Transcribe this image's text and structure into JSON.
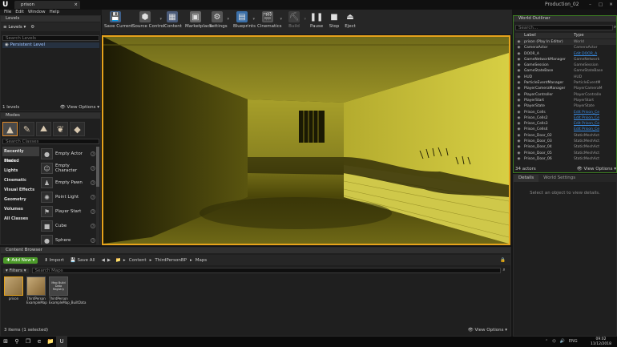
{
  "title_bar": {
    "doc_tab": "prison",
    "project_name": "Production_02",
    "controls": [
      "–",
      "□",
      "✕"
    ]
  },
  "menu": [
    "File",
    "Edit",
    "Window",
    "Help"
  ],
  "levels_panel": {
    "tab": "Levels",
    "levels_button": "Levels",
    "search_placeholder": "Search Levels",
    "persistent_level": "Persistent Level",
    "count": "1 levels",
    "view_options": "View Options"
  },
  "modes_panel": {
    "tab": "Modes",
    "search_placeholder": "Search Classes",
    "categories": [
      "Recently Placed",
      "Basic",
      "Lights",
      "Cinematic",
      "Visual Effects",
      "Geometry",
      "Volumes",
      "All Classes"
    ],
    "place_items": [
      "Empty Actor",
      "Empty Character",
      "Empty Pawn",
      "Point Light",
      "Player Start",
      "Cube",
      "Sphere"
    ]
  },
  "toolbar": [
    {
      "label": "Save Current",
      "icon": "save-icon"
    },
    {
      "label": "Source Control",
      "icon": "source-control-icon"
    },
    {
      "label": "Content",
      "icon": "content-icon"
    },
    {
      "label": "Marketplace",
      "icon": "marketplace-icon"
    },
    {
      "label": "Settings",
      "icon": "settings-icon"
    },
    {
      "label": "Blueprints",
      "icon": "blueprints-icon"
    },
    {
      "label": "Cinematics",
      "icon": "cinematics-icon"
    },
    {
      "label": "Build",
      "icon": "build-icon"
    },
    {
      "label": "Pause",
      "icon": "pause-icon"
    },
    {
      "label": "Stop",
      "icon": "stop-icon"
    },
    {
      "label": "Eject",
      "icon": "eject-icon"
    }
  ],
  "outliner": {
    "tab": "World Outliner",
    "search_placeholder": "Search...",
    "col_label": "Label",
    "col_type": "Type",
    "rows": [
      {
        "name": "prison (Play In Editor)",
        "type": "World",
        "link": false
      },
      {
        "name": "CameraActor",
        "type": "CameraActor",
        "link": false
      },
      {
        "name": "DOOR_A",
        "type": "Edit DOOR_A",
        "link": true
      },
      {
        "name": "GameNetworkManager",
        "type": "GameNetwork",
        "link": false
      },
      {
        "name": "GameSession",
        "type": "GameSession",
        "link": false
      },
      {
        "name": "GameStateBase",
        "type": "GameStateBase",
        "link": false
      },
      {
        "name": "HUD",
        "type": "HUD",
        "link": false
      },
      {
        "name": "ParticleEventManager",
        "type": "ParticleEventM",
        "link": false
      },
      {
        "name": "PlayerCameraManager",
        "type": "PlayerCameraM",
        "link": false
      },
      {
        "name": "PlayerController",
        "type": "PlayerControlle",
        "link": false
      },
      {
        "name": "PlayerStart",
        "type": "PlayerStart",
        "link": false
      },
      {
        "name": "PlayerState",
        "type": "PlayerState",
        "link": false
      },
      {
        "name": "Prison_Cells",
        "type": "Edit Prison_Ce",
        "link": true
      },
      {
        "name": "Prison_Cells2",
        "type": "Edit Prison_Ce",
        "link": true
      },
      {
        "name": "Prison_Cells3",
        "type": "Edit Prison_Ce",
        "link": true
      },
      {
        "name": "Prison_Cells4",
        "type": "Edit Prison_Ce",
        "link": true
      },
      {
        "name": "Prison_Door_02",
        "type": "StaticMeshAct",
        "link": false
      },
      {
        "name": "Prison_Door_03",
        "type": "StaticMeshAct",
        "link": false
      },
      {
        "name": "Prison_Door_04",
        "type": "StaticMeshAct",
        "link": false
      },
      {
        "name": "Prison_Door_05",
        "type": "StaticMeshAct",
        "link": false
      },
      {
        "name": "Prison_Door_06",
        "type": "StaticMeshAct",
        "link": false
      }
    ],
    "actor_count": "34 actors",
    "view_options": "View Options"
  },
  "details": {
    "tab": "Details",
    "tab2": "World Settings",
    "message": "Select an object to view details."
  },
  "content_browser": {
    "tab": "Content Browser",
    "add_new": "Add New",
    "import": "Import",
    "save_all": "Save All",
    "path": [
      "Content",
      "ThirdPersonBP",
      "Maps"
    ],
    "filters": "Filters",
    "search_placeholder": "Search Maps",
    "assets": [
      {
        "label": "prison"
      },
      {
        "label": "ThirdPerson ExampleMap"
      },
      {
        "label": "ThirdPerson ExampleMap_BuiltData"
      }
    ],
    "map_thumb_text": "Map Build Data Registry",
    "status": "3 items (1 selected)",
    "view_options": "View Options"
  },
  "taskbar": {
    "lang": "ENG",
    "time": "09:02",
    "date": "11/12/2018"
  },
  "colors": {
    "accent_orange": "#e6a31c",
    "outliner_border": "#3b7a22",
    "add_new_green": "#4c9a2a",
    "link_blue": "#3a8ee6"
  }
}
